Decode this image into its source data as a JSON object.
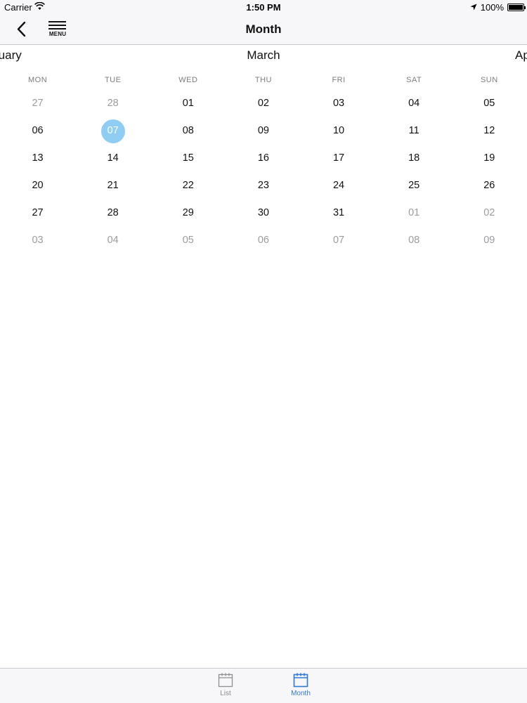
{
  "status": {
    "carrier": "Carrier",
    "time": "1:50 PM",
    "battery": "100%"
  },
  "nav": {
    "title": "Month",
    "menu_label": "MENU"
  },
  "months": {
    "prev": "ruary",
    "current": "March",
    "next": "Ap"
  },
  "weekdays": [
    "MON",
    "TUE",
    "WED",
    "THU",
    "FRI",
    "SAT",
    "SUN"
  ],
  "weeks": [
    [
      "27",
      "28",
      "01",
      "02",
      "03",
      "04",
      "05"
    ],
    [
      "06",
      "07",
      "08",
      "09",
      "10",
      "11",
      "12"
    ],
    [
      "13",
      "14",
      "15",
      "16",
      "17",
      "18",
      "19"
    ],
    [
      "20",
      "21",
      "22",
      "23",
      "24",
      "25",
      "26"
    ],
    [
      "27",
      "28",
      "29",
      "30",
      "31",
      "01",
      "02"
    ],
    [
      "03",
      "04",
      "05",
      "06",
      "07",
      "08",
      "09"
    ]
  ],
  "selected_day": "07",
  "tabs": {
    "list": "List",
    "month": "Month"
  },
  "colors": {
    "selected_circle": "#8fcdf2",
    "active_tab": "#2f7bd3",
    "inactive_tab": "#8e8e93"
  }
}
